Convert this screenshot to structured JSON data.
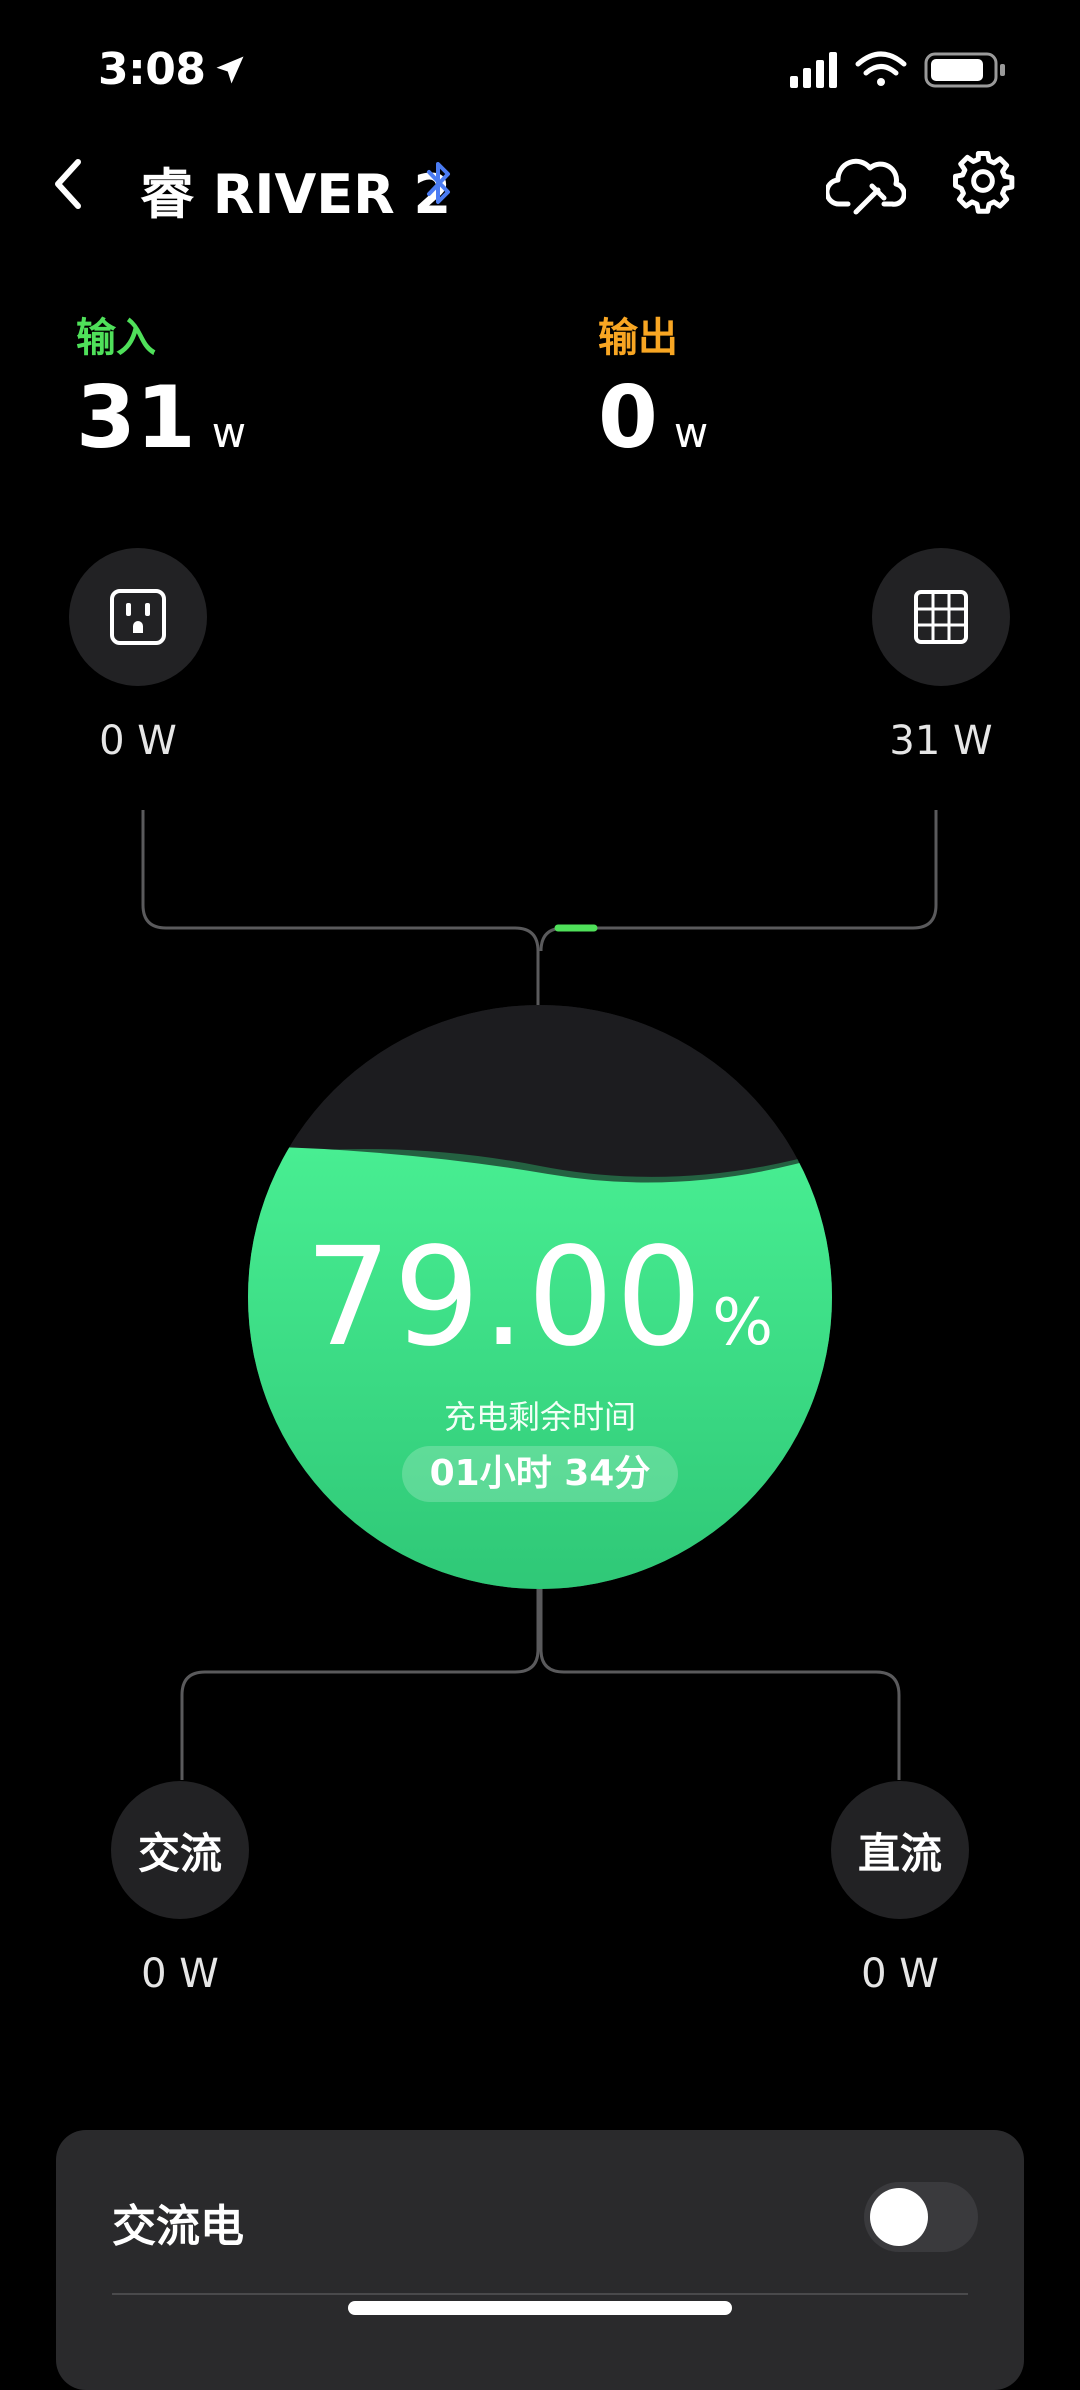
{
  "status_bar": {
    "time": "3:08"
  },
  "header": {
    "title": "睿 RIVER 2",
    "bluetooth_icon": "bluetooth-icon",
    "cloud_icon": "cloud-icon",
    "settings_icon": "gear-icon"
  },
  "stats": {
    "input": {
      "label": "输入",
      "value": "31",
      "unit": "w",
      "color": "#4fe05a"
    },
    "output": {
      "label": "输出",
      "value": "0",
      "unit": "w",
      "color": "#f8a623"
    }
  },
  "sources": {
    "ac_input": {
      "icon": "outlet-icon",
      "watts": "0 W"
    },
    "solar_input": {
      "icon": "solar-panel-icon",
      "watts": "31 W"
    }
  },
  "battery": {
    "percent": "79.00",
    "percent_sign": "%",
    "level": 0.79,
    "label": "充电剩余时间",
    "time_remaining": "01小时 34分",
    "fill_color": "#3ee58a"
  },
  "outputs": {
    "ac": {
      "label": "交流",
      "watts": "0 W"
    },
    "dc": {
      "label": "直流",
      "watts": "0 W"
    }
  },
  "card": {
    "ac_label": "交流电",
    "ac_enabled": false
  }
}
